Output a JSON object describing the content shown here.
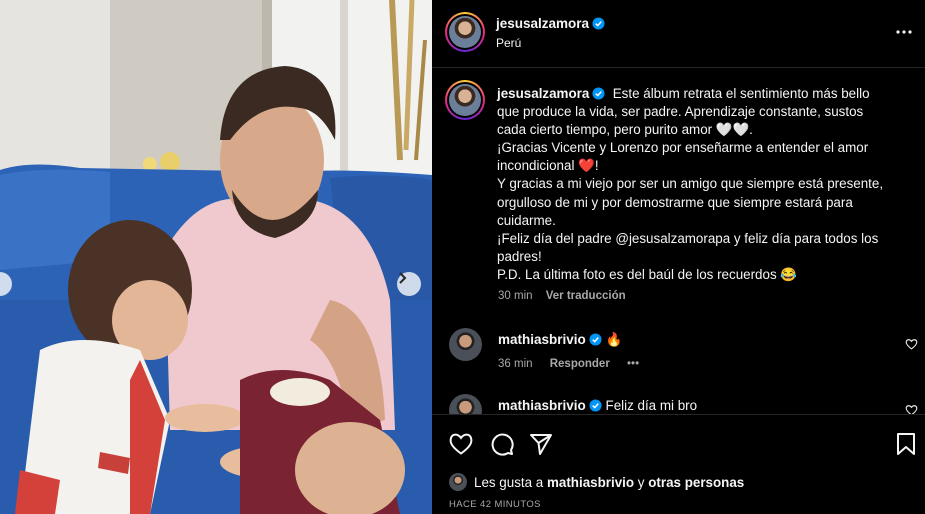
{
  "post": {
    "author": "jesusalzamora",
    "location": "Perú",
    "caption_lines": [
      "Este álbum retrata el sentimiento más bello",
      "que produce la vida, ser padre. Aprendizaje constante, sustos",
      "cada cierto tiempo, pero purito amor 🤍🤍.",
      "¡Gracias Vicente y Lorenzo por enseñarme a entender el amor",
      "incondicional ❤️!",
      "Y gracias a mi viejo por ser un amigo que siempre está presente,",
      "orgulloso de mi y por demostrarme que siempre estará para",
      "cuidarme.",
      "¡Feliz día del padre @jesusalzamorapa y feliz día para todos los",
      "padres!",
      "P.D. La última foto es del baúl de los recuerdos 😂"
    ],
    "time": "30 min",
    "translate_label": "Ver traducción"
  },
  "comments": [
    {
      "user": "mathiasbrivio",
      "text": "🔥",
      "time": "36 min",
      "reply_label": "Responder",
      "more": "•••"
    },
    {
      "user": "mathiasbrivio",
      "text": "Feliz día mi bro"
    }
  ],
  "likes": {
    "prefix": "Les gusta a",
    "user": "mathiasbrivio",
    "middle": "y",
    "others": "otras personas"
  },
  "time_ago": "HACE 42 MINUTOS",
  "icons": {
    "more": "more-options-icon",
    "like": "heart-icon",
    "comment": "comment-icon",
    "share": "share-icon",
    "save": "bookmark-icon",
    "next": "chevron-right-icon",
    "prev": "chevron-left-icon",
    "verified": "verified-badge-icon"
  },
  "colors": {
    "background": "#000000",
    "text": "#f5f5f5",
    "muted": "#a8a8a8",
    "verified": "#0095f6",
    "divider": "#262626"
  }
}
